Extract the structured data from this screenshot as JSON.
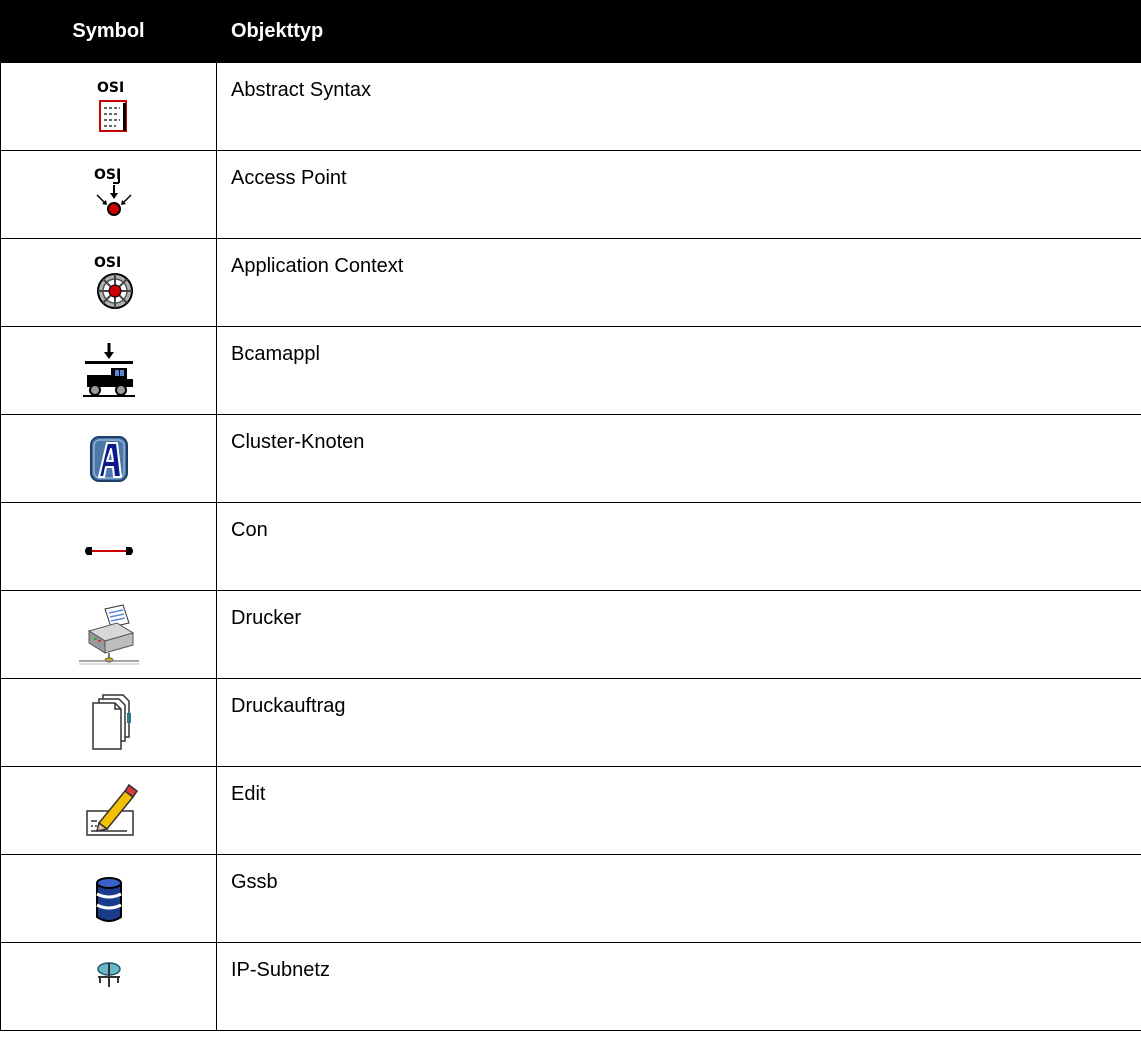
{
  "table": {
    "headers": {
      "symbol": "Symbol",
      "object_type": "Objekttyp"
    },
    "rows": [
      {
        "icon": "osi-abstract-syntax-icon",
        "label": "Abstract Syntax"
      },
      {
        "icon": "osi-access-point-icon",
        "label": "Access Point"
      },
      {
        "icon": "osi-application-context-icon",
        "label": "Application Context"
      },
      {
        "icon": "bcamappl-truck-icon",
        "label": "Bcamappl"
      },
      {
        "icon": "cluster-node-a-icon",
        "label": "Cluster-Knoten"
      },
      {
        "icon": "connection-line-icon",
        "label": "Con"
      },
      {
        "icon": "printer-icon",
        "label": "Drucker"
      },
      {
        "icon": "print-job-pages-icon",
        "label": "Druckauftrag"
      },
      {
        "icon": "edit-pencil-icon",
        "label": "Edit"
      },
      {
        "icon": "database-stack-icon",
        "label": "Gssb"
      },
      {
        "icon": "ip-subnet-icon",
        "label": "IP-Subnetz"
      }
    ]
  },
  "icon_label": "OSI",
  "colors": {
    "header_bg": "#000000",
    "header_text": "#ffffff",
    "accent_red": "#cc0000",
    "accent_blue": "#1a3a8c"
  }
}
